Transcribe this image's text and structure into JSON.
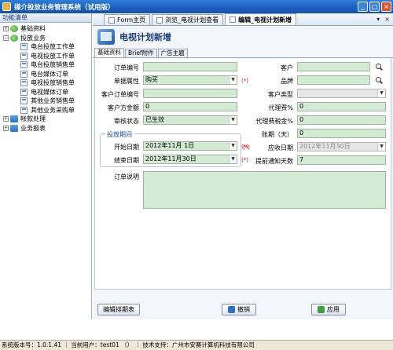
{
  "app": {
    "title": "媒介投放业务管理系统（试用版）"
  },
  "window_buttons": {
    "minimize": "_",
    "maximize": "□",
    "close": "×"
  },
  "sidebar": {
    "header": "功能清单",
    "tree": [
      {
        "label": "基础资料",
        "expander": "+"
      },
      {
        "label": "投放业务",
        "expander": "−"
      },
      {
        "label": "电台投放工作单"
      },
      {
        "label": "电视投放工作单"
      },
      {
        "label": "电台投放销售单"
      },
      {
        "label": "电台媒体订单"
      },
      {
        "label": "电视投放销售单"
      },
      {
        "label": "电视媒体订单"
      },
      {
        "label": "其他业务销售单"
      },
      {
        "label": "其他业务采购单"
      },
      {
        "label": "帐款处理",
        "expander": "+"
      },
      {
        "label": "业务报表",
        "expander": "+"
      }
    ]
  },
  "tabs": [
    {
      "label": "Form主页"
    },
    {
      "label": "浏览_电视计划查看"
    },
    {
      "label": "编辑_电视计划新增"
    }
  ],
  "tab_controls": {
    "menu": "▾",
    "close": "×"
  },
  "page": {
    "title": "电视计划新增"
  },
  "subtabs": [
    "基础资料",
    "Brief附件",
    "广告主题"
  ],
  "form": {
    "order_no_label": "订单编号",
    "order_no": "",
    "doc_type_label": "单据属性",
    "doc_type": "购买",
    "cust_order_no_label": "客户订单编号",
    "cust_order_no": "",
    "cust_amount_label": "客户方金额",
    "cust_amount": "0",
    "audit_label": "审核状态",
    "audit": "已生效",
    "period_group_label": "投放期间",
    "start_label": "开始日期",
    "start": "2012年11月 1日",
    "end_label": "结束日期",
    "end": "2012年11月30日",
    "customer_label": "客户",
    "customer": "",
    "brand_label": "品牌",
    "brand": "",
    "cust_type_label": "客户类型",
    "cust_type": "",
    "agency_fee_label": "代理费%",
    "agency_fee": "0",
    "agency_tax_label": "代理费税金%",
    "agency_tax": "0",
    "account_days_label": "账期（天）",
    "account_days": "0",
    "receivable_label": "应收日期",
    "receivable": "2012年11月30日",
    "notice_days_label": "提前通知天数",
    "notice_days": "7",
    "memo_label": "订单说明",
    "memo": "",
    "required_mark": "(*)",
    "dropdown_arrow": "▼"
  },
  "buttons": {
    "edit_schedule": "编辑排期表",
    "cancel": "撤销",
    "apply": "应用"
  },
  "status_bar": "系统版本号：1.0.1.41 ｜ 当前用户：test01 （） ｜ 技术支持：广州市安赛计算机科技有限公司"
}
